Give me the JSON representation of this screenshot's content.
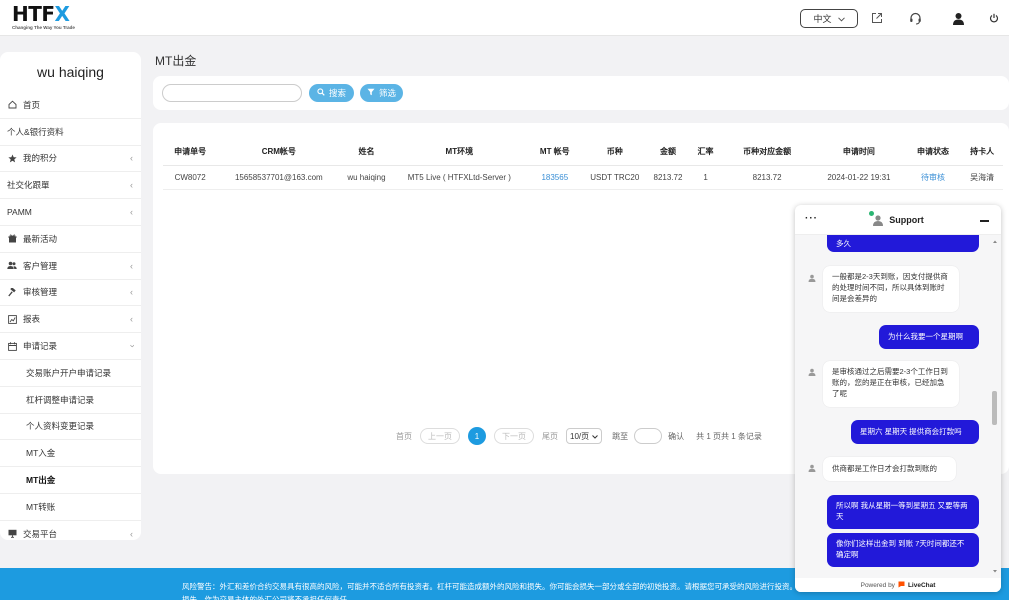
{
  "header": {
    "logo_text": "HTFX",
    "logo_tagline": "Changing The Way You Trade",
    "language": "中文"
  },
  "sidebar": {
    "user_name": "wu haiqing",
    "items": [
      {
        "label": "首页",
        "icon": "home-icon"
      },
      {
        "label": "个人&银行资料",
        "icon": ""
      },
      {
        "label": "我的积分",
        "icon": "star-icon",
        "chevron": true
      },
      {
        "label": "社交化跟單",
        "icon": "",
        "chevron": true
      },
      {
        "label": "PAMM",
        "icon": "",
        "chevron": true
      },
      {
        "label": "最新活动",
        "icon": "gift-icon"
      },
      {
        "label": "客户管理",
        "icon": "users-icon",
        "chevron": true
      },
      {
        "label": "审核管理",
        "icon": "gavel-icon",
        "chevron": true
      },
      {
        "label": "报表",
        "icon": "chart-icon",
        "chevron": true
      },
      {
        "label": "申请记录",
        "icon": "calendar-icon",
        "chevron": true
      },
      {
        "label": "交易账户开户申请记录",
        "sub": true
      },
      {
        "label": "杠杆调整申请记录",
        "sub": true
      },
      {
        "label": "个人资料变更记录",
        "sub": true
      },
      {
        "label": "MT入金",
        "sub": true
      },
      {
        "label": "MT出金",
        "sub": true,
        "active": true
      },
      {
        "label": "MT转账",
        "sub": true
      },
      {
        "label": "交易平台",
        "icon": "monitor-icon",
        "chevron": true
      }
    ]
  },
  "page": {
    "title": "MT出金",
    "search_label": "搜索",
    "filter_label": "筛选"
  },
  "table": {
    "columns": [
      "申请单号",
      "CRM帐号",
      "姓名",
      "MT环境",
      "MT 帐号",
      "币种",
      "金额",
      "汇率",
      "币种对应金额",
      "申请时间",
      "申请状态",
      "持卡人"
    ],
    "rows": [
      [
        "CW8072",
        "15658537701@163.com",
        "wu haiqing",
        "MT5 Live ( HTFXLtd-Server )",
        "183565",
        "USDT TRC20",
        "8213.72",
        "1",
        "8213.72",
        "2024-01-22 19:31",
        "待审核",
        "吴海清"
      ]
    ]
  },
  "pagination": {
    "first": "首页",
    "prev": "上一页",
    "current": "1",
    "next": "下一页",
    "last": "尾页",
    "page_size": "10/页",
    "jump_label": "跳至",
    "confirm": "确认",
    "summary": "共 1 页共 1 条记录"
  },
  "footer": {
    "text": "风险警告：外汇和差价合约交易具有很高的风险，可能并不适合所有投资者。杠杆可能造成额外的风险和损失。你可能会损失一部分或全部的初始投资。请根据您可承受的风险进行投资。在交易前，请了解交易相关的风险。任何由您的投资造成的损失，作为交易主体的外汇公司将不承担任何责任。"
  },
  "chat": {
    "title": "Support",
    "powered_by": "Powered by",
    "brand": "LiveChat",
    "messages": [
      {
        "from": "customer",
        "text": "多久"
      },
      {
        "from": "agent",
        "text": "一般都是2-3天到账，因支付提供商的处理时间不同，所以具体到账时间是会差异的"
      },
      {
        "from": "customer",
        "text": "为什么我要一个星期啊"
      },
      {
        "from": "agent",
        "text": "是审核通过之后需要2-3个工作日到账的，您的是正在审核，已经加急了呢"
      },
      {
        "from": "customer",
        "text": "星期六 星期天 提供商会打款吗"
      },
      {
        "from": "agent",
        "text": "供商都是工作日才会打款到账的"
      },
      {
        "from": "customer",
        "text": "所以啊 我从星期一等到星期五 又要等两天"
      },
      {
        "from": "customer",
        "text": "像你们这样出金到 到账 7天时间都还不确定啊"
      }
    ]
  }
}
